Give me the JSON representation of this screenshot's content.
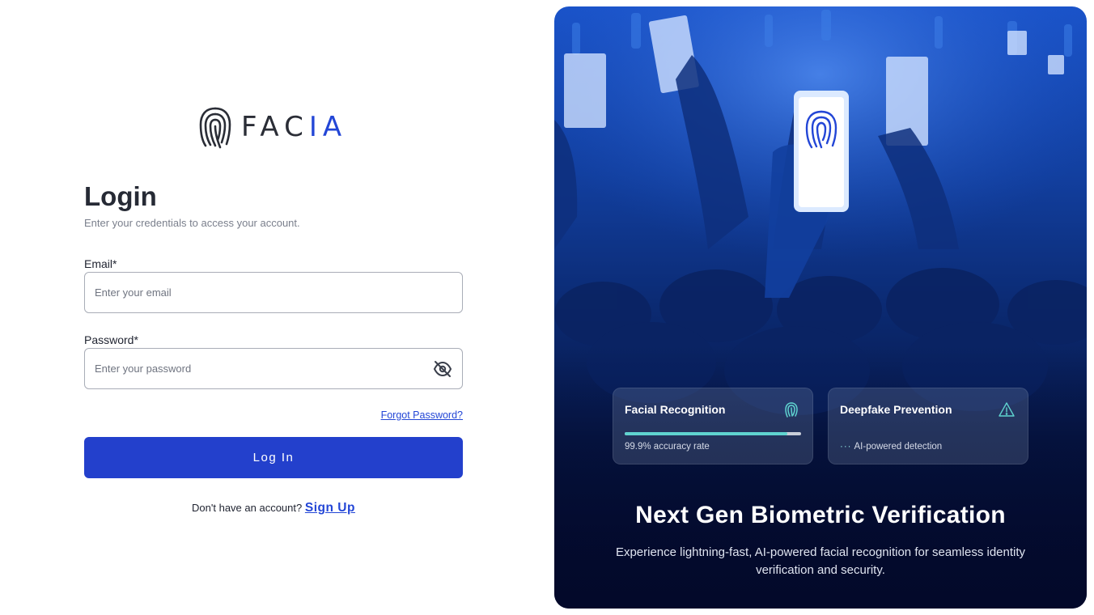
{
  "brand": {
    "logo_text_main": "FAC",
    "logo_text_accent": "IA",
    "logo_icon": "fingerprint-icon"
  },
  "login": {
    "title": "Login",
    "subtitle": "Enter your credentials to access your account.",
    "email_label": "Email*",
    "email_placeholder": "Enter your email",
    "email_value": "",
    "password_label": "Password*",
    "password_placeholder": "Enter your password",
    "password_value": "",
    "password_toggle_icon": "eye-off-icon",
    "forgot_link": "Forgot Password?",
    "submit_label": "Log In",
    "signup_prompt": "Don't have an account?",
    "signup_link": "Sign Up"
  },
  "promo": {
    "cards": [
      {
        "title": "Facial Recognition",
        "icon": "fingerprint-icon",
        "progress": 0.92,
        "caption": "99.9% accuracy rate"
      },
      {
        "title": "Deepfake Prevention",
        "icon": "warning-triangle-icon",
        "dots": "···",
        "caption": "AI-powered detection"
      }
    ],
    "headline": "Next Gen Biometric Verification",
    "description": "Experience lightning-fast, AI-powered facial recognition for seamless identity verification and security."
  },
  "colors": {
    "primary": "#2340cc",
    "link": "#2346d6",
    "accent_teal": "#5fd3cf",
    "panel_top": "#1a53c9",
    "panel_bottom": "#03092a"
  }
}
